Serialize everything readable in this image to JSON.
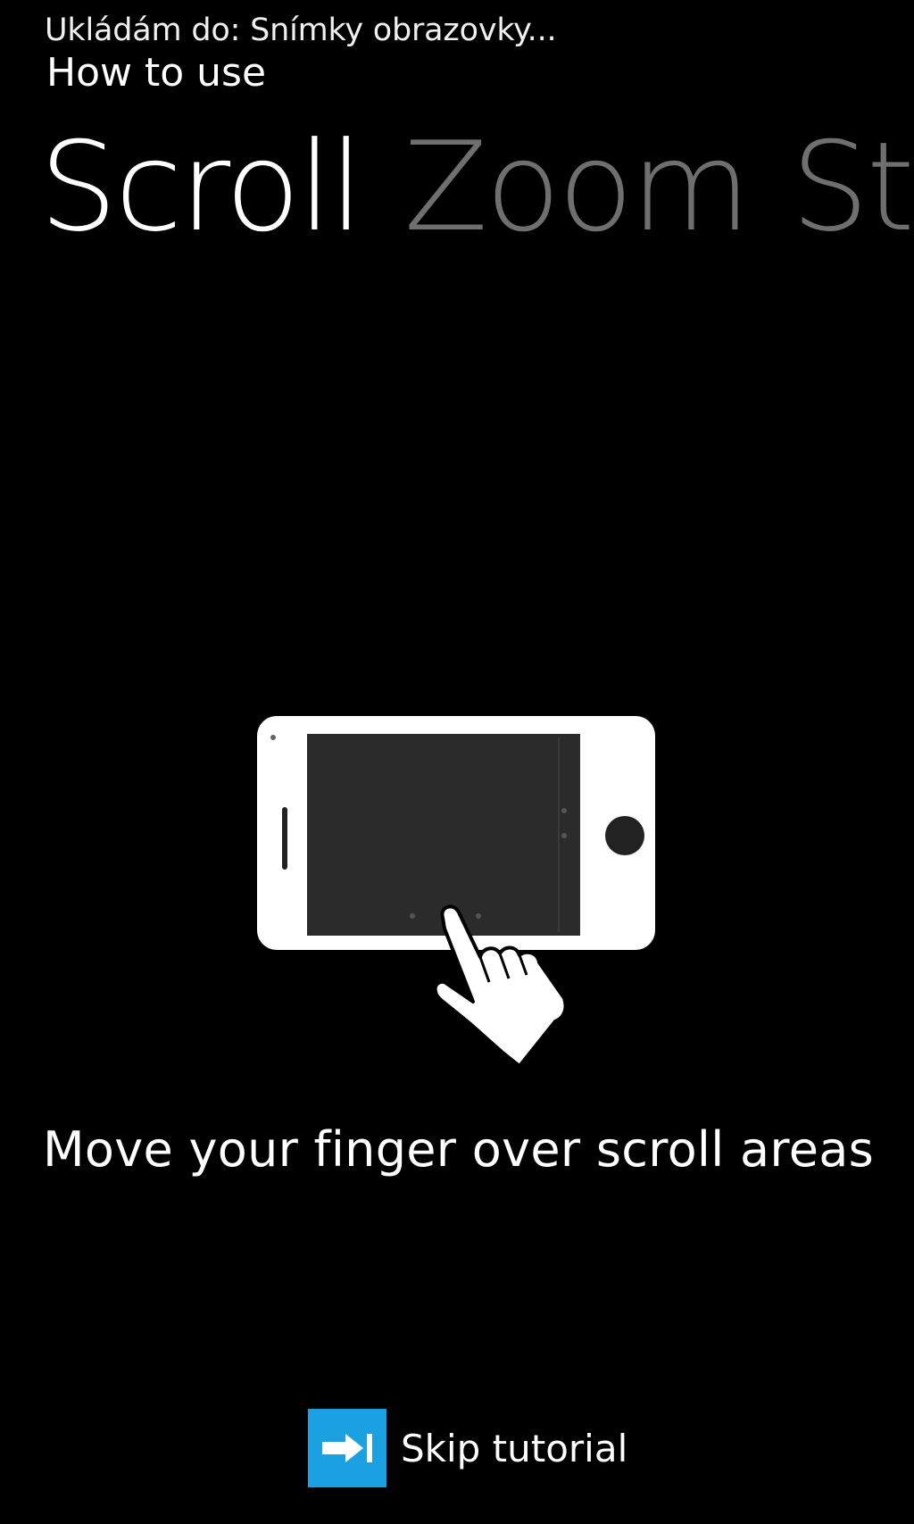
{
  "status": {
    "text": "Ukládám do: Snímky obrazovky..."
  },
  "app": {
    "title": "How to use"
  },
  "pivot": {
    "items": [
      {
        "label": "Scroll",
        "active": true
      },
      {
        "label": "Zoom",
        "active": false
      },
      {
        "label": "St",
        "active": false
      }
    ]
  },
  "tutorial": {
    "instruction": "Move your finger over scroll areas",
    "skip_label": "Skip tutorial"
  },
  "colors": {
    "background": "#000000",
    "accent": "#1ba1e2",
    "inactive_header": "#6f6f6f",
    "phone_body": "#ffffff",
    "phone_screen": "#2b2b2b"
  },
  "icons": {
    "skip": "arrow-right-to-bar-icon",
    "phone": "phone-landscape-icon",
    "hand": "pointing-hand-icon"
  }
}
